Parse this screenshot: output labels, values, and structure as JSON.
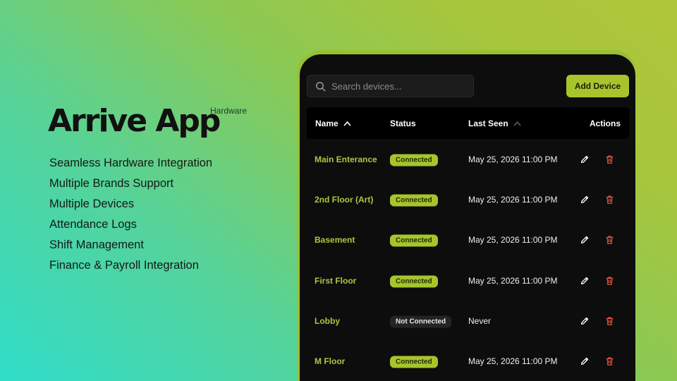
{
  "brand": {
    "title": "Arrive App",
    "tag": "Hardware"
  },
  "features": [
    "Seamless Hardware Integration",
    "Multiple Brands Support",
    "Multiple Devices",
    "Attendance Logs",
    "Shift Management",
    "Finance & Payroll Integration"
  ],
  "toolbar": {
    "search_placeholder": "Search devices...",
    "add_label": "Add Device"
  },
  "table": {
    "headers": {
      "name": "Name",
      "status": "Status",
      "last_seen": "Last Seen",
      "actions": "Actions"
    },
    "rows": [
      {
        "name": "Main Enterance",
        "status": "Connected",
        "connected": true,
        "last_seen": "May 25, 2026 11:00 PM"
      },
      {
        "name": "2nd Floor (Art)",
        "status": "Connected",
        "connected": true,
        "last_seen": "May 25, 2026 11:00 PM"
      },
      {
        "name": "Basement",
        "status": "Connected",
        "connected": true,
        "last_seen": "May 25, 2026 11:00 PM"
      },
      {
        "name": "First Floor",
        "status": "Connected",
        "connected": true,
        "last_seen": "May 25, 2026 11:00 PM"
      },
      {
        "name": "Lobby",
        "status": "Not Connected",
        "connected": false,
        "last_seen": "Never"
      },
      {
        "name": "M Floor",
        "status": "Connected",
        "connected": true,
        "last_seen": "May 25, 2026 11:00 PM"
      }
    ]
  },
  "colors": {
    "accent": "#a7c52b",
    "delete": "#e0543e",
    "panel": "#0d0d0d"
  }
}
